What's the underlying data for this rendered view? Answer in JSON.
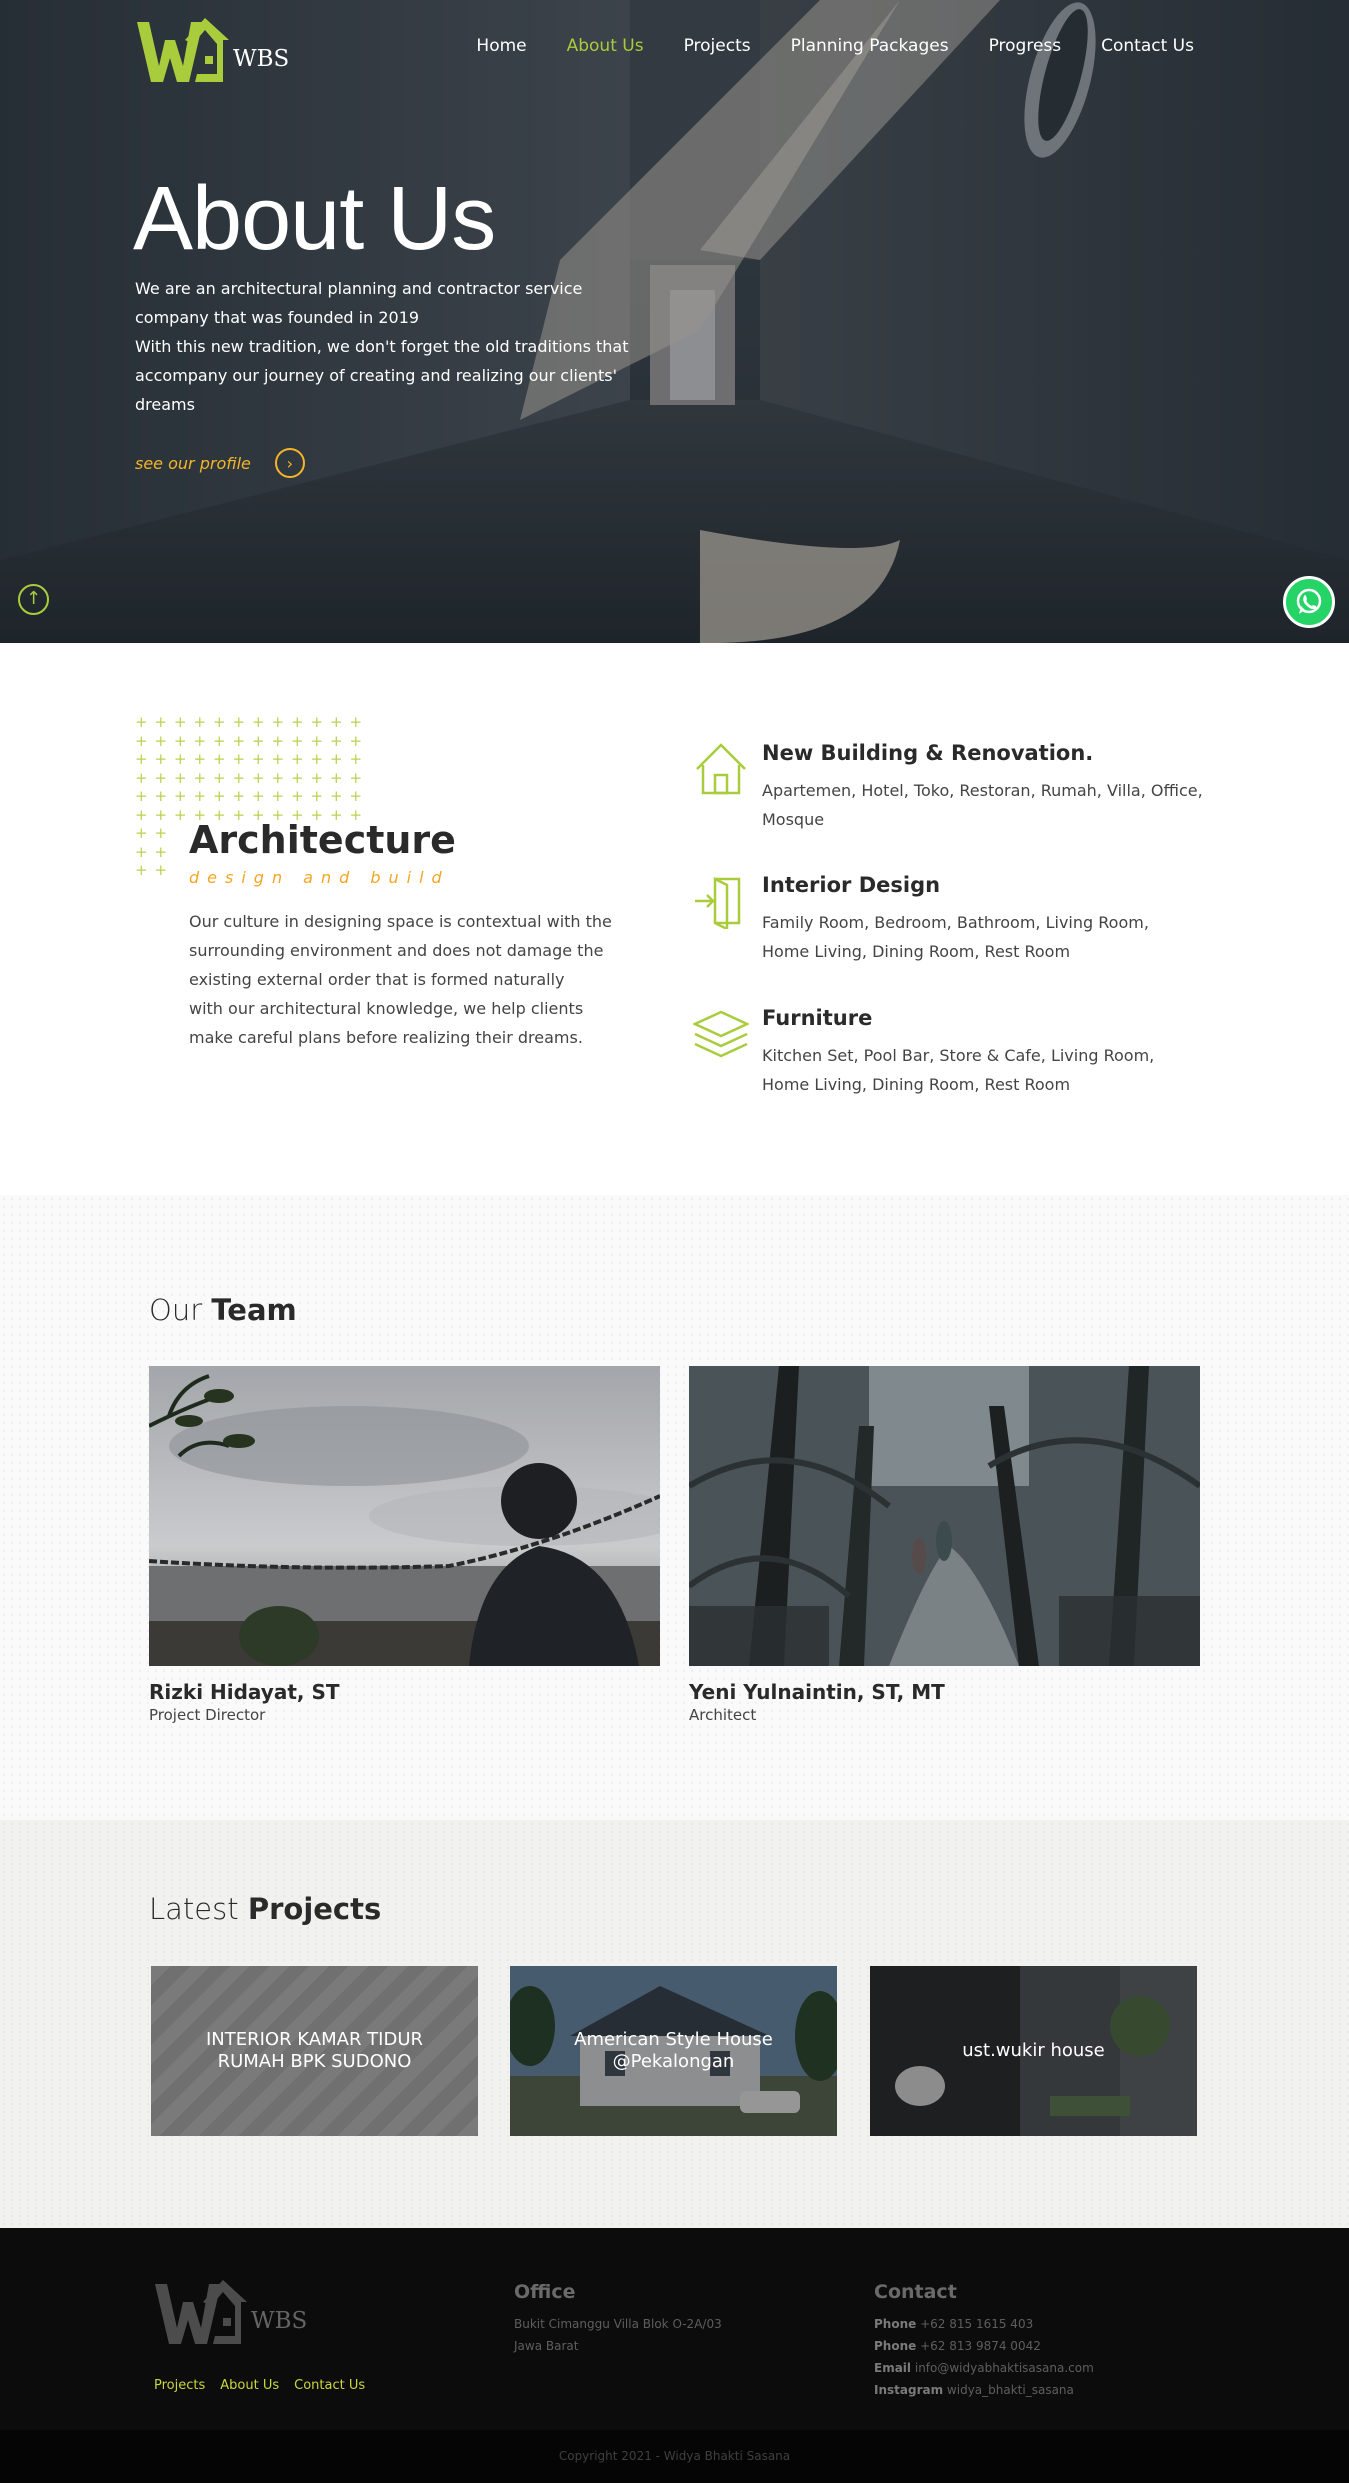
{
  "brand": {
    "logo_text": "WBS",
    "accent": "#a9cc3c",
    "link_color": "#f4b52a"
  },
  "nav": {
    "items": [
      {
        "label": "Home"
      },
      {
        "label": "About Us"
      },
      {
        "label": "Projects"
      },
      {
        "label": "Planning Packages"
      },
      {
        "label": "Progress"
      },
      {
        "label": "Contact Us"
      }
    ],
    "active": "About Us"
  },
  "hero": {
    "title": "About Us",
    "lines": [
      "We are an architectural planning and contractor service",
      "company that was founded in 2019",
      "With this new tradition, we don't forget the old traditions that",
      "accompany our journey of creating and realizing our clients'",
      "dreams"
    ],
    "link_label": "see our profile",
    "link_icon": "chevron-right-icon",
    "scroll_top_icon": "arrow-up-icon",
    "whatsapp_icon": "whatsapp-icon"
  },
  "architecture": {
    "title": "Architecture",
    "subtitle": "design and build",
    "lines": [
      "Our culture in designing space is contextual with the",
      "surrounding environment and does not damage the",
      "existing external order that is formed naturally",
      "with our architectural knowledge, we help clients",
      "make careful plans before realizing their dreams."
    ]
  },
  "services": [
    {
      "icon": "house-icon",
      "title": "New Building & Renovation.",
      "lines": [
        "Apartemen, Hotel, Toko, Restoran, Rumah, Villa, Office,",
        "Mosque"
      ]
    },
    {
      "icon": "door-icon",
      "title": "Interior Design",
      "lines": [
        "Family Room, Bedroom, Bathroom, Living Room,",
        "Home Living, Dining Room, Rest Room"
      ]
    },
    {
      "icon": "layers-icon",
      "title": "Furniture",
      "lines": [
        "Kitchen Set, Pool Bar, Store & Cafe, Living Room,",
        "Home Living, Dining Room, Rest Room"
      ]
    }
  ],
  "team": {
    "title_light": "Our",
    "title_bold": "Team",
    "members": [
      {
        "name": "Rizki Hidayat, ST",
        "role": "Project Director"
      },
      {
        "name": "Yeni Yulnaintin, ST, MT",
        "role": "Architect"
      }
    ]
  },
  "projects": {
    "title_light": "Latest",
    "title_bold": "Projects",
    "items": [
      {
        "lines": [
          "INTERIOR KAMAR TIDUR",
          "RUMAH BPK SUDONO"
        ]
      },
      {
        "lines": [
          "American Style House",
          "@Pekalongan"
        ]
      },
      {
        "lines": [
          "ust.wukir house"
        ]
      }
    ]
  },
  "footer": {
    "links": [
      "Projects",
      "About Us",
      "Contact Us"
    ],
    "office": {
      "title": "Office",
      "lines": [
        "Bukit Cimanggu Villa Blok O-2A/03",
        "Jawa Barat"
      ]
    },
    "contact": {
      "title": "Contact",
      "rows": [
        {
          "label": "Phone",
          "value": "+62 815 1615 403"
        },
        {
          "label": "Phone",
          "value": "+62 813 9874 0042"
        },
        {
          "label": "Email",
          "value": "info@widyabhaktisasana.com"
        },
        {
          "label": "Instagram",
          "value": "widya_bhakti_sasana"
        }
      ]
    },
    "copyright": "Copyright 2021 - Widya Bhakti Sasana"
  }
}
